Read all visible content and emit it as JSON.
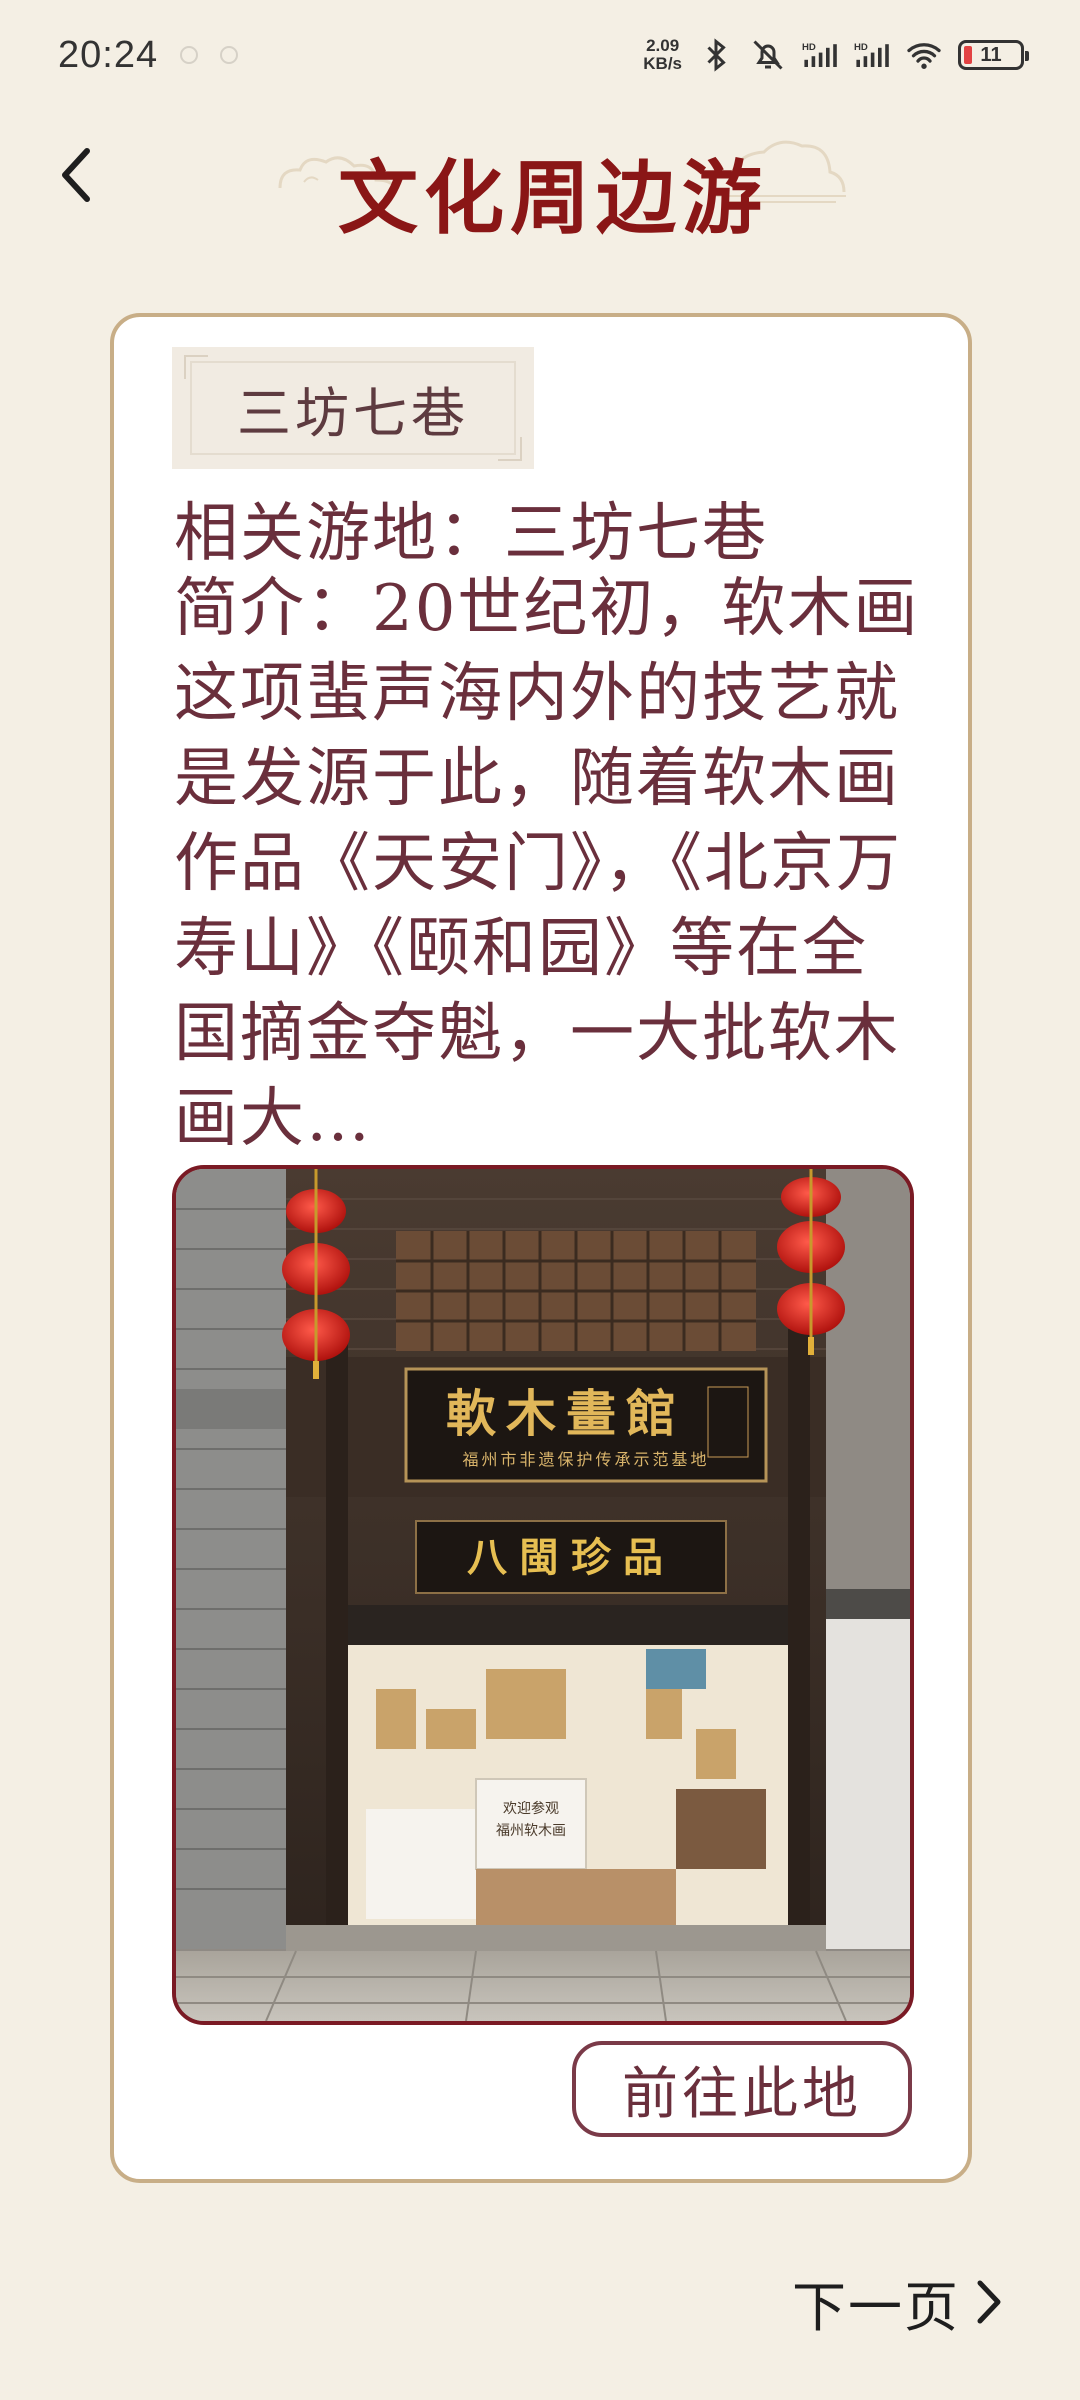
{
  "status_bar": {
    "time": "20:24",
    "net_speed_value": "2.09",
    "net_speed_unit": "KB/s",
    "battery_level": "11",
    "icons": [
      "notification-dot-icon",
      "bluetooth-icon",
      "bell-off-icon",
      "signal-hd-icon",
      "signal-hd-icon",
      "wifi-icon",
      "battery-icon"
    ]
  },
  "header": {
    "title": "文化周边游",
    "back_icon": "chevron-left-icon"
  },
  "card": {
    "tag_label": "三坊七巷",
    "location_line": "相关游地：三坊七巷",
    "intro_text": "简介：20世纪初，软木画这项蜚声海内外的技艺就是发源于此，随着软木画作品《天安门》，《北京万寿山》《颐和园》等在全国摘金夺魁，一大批软木画大…",
    "photo": {
      "sign_main": "軟木畫館",
      "sign_sub": "福州市非遗保护传承示范基地",
      "sign_second": "八閩珍品",
      "shop_notice_1": "欢迎参观",
      "shop_notice_2": "福州软木画"
    },
    "go_button_label": "前往此地"
  },
  "footer": {
    "next_label": "下一页",
    "next_icon": "chevron-right-icon"
  },
  "colors": {
    "background": "#f4efe4",
    "title": "#8a1616",
    "body_text": "#6a2f3c",
    "card_border": "#c8ae87",
    "photo_border": "#7a1a24"
  }
}
